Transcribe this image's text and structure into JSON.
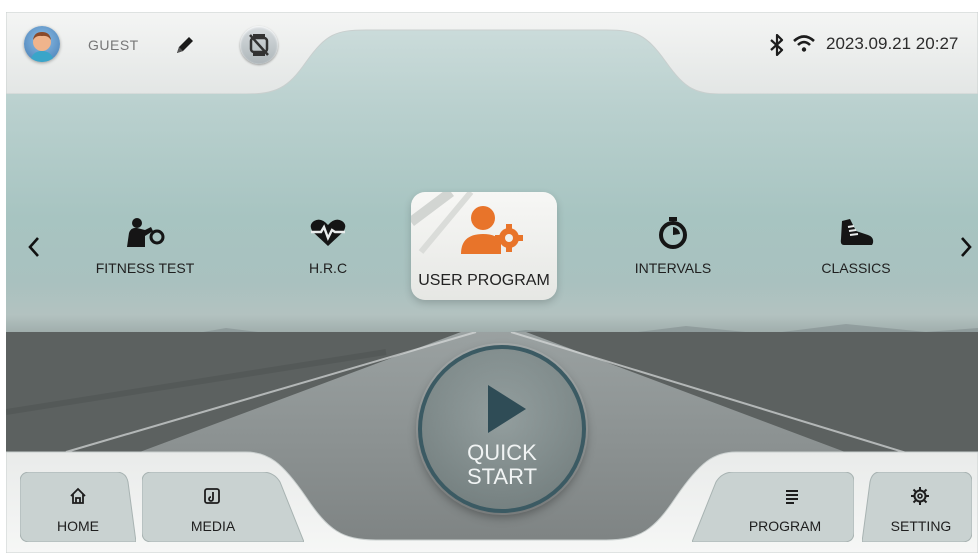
{
  "header": {
    "user_name": "GUEST",
    "datetime": "2023.09.21 20:27",
    "icons": [
      "avatar",
      "pencil-icon",
      "watch-disconnected-icon",
      "bluetooth-icon",
      "wifi-icon"
    ]
  },
  "carousel": {
    "prev_icon": "chevron-left-icon",
    "next_icon": "chevron-right-icon",
    "items": [
      {
        "label": "FITNESS TEST",
        "icon": "fitness-test-icon"
      },
      {
        "label": "H.R.C",
        "icon": "heart-rate-icon"
      },
      {
        "label": "USER PROGRAM",
        "icon": "user-program-icon",
        "selected": true
      },
      {
        "label": "INTERVALS",
        "icon": "stopwatch-icon"
      },
      {
        "label": "CLASSICS",
        "icon": "running-shoe-icon"
      }
    ]
  },
  "quick_start": {
    "line1": "QUICK",
    "line2": "START",
    "icon": "play-icon"
  },
  "bottom_nav": {
    "home": "HOME",
    "media": "MEDIA",
    "program": "PROGRAM",
    "setting": "SETTING"
  },
  "colors": {
    "accent_orange": "#e8742a",
    "ring": "#3b5a63",
    "bar": "#eceeed"
  }
}
